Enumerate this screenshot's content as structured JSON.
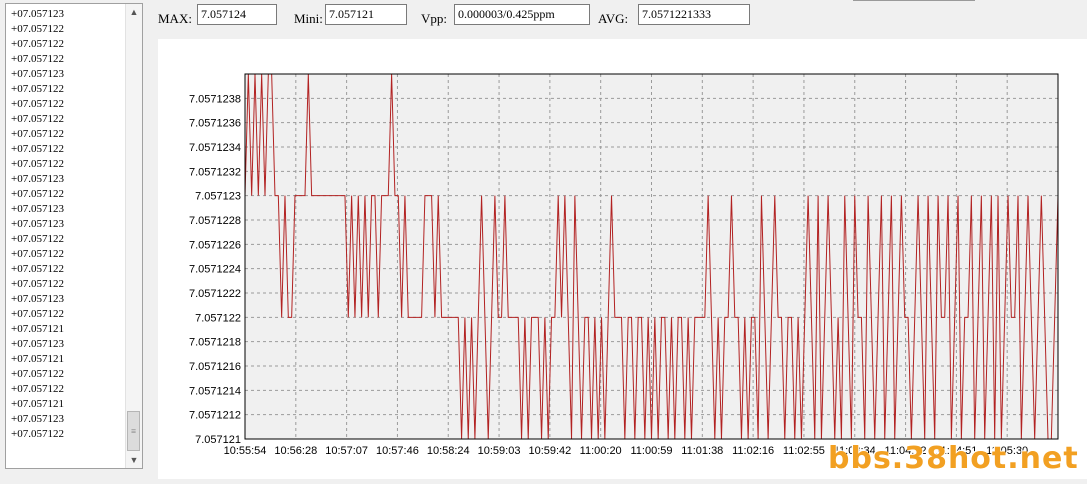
{
  "readings": [
    "+07.057123",
    "+07.057122",
    "+07.057122",
    "+07.057122",
    "+07.057123",
    "+07.057122",
    "+07.057122",
    "+07.057122",
    "+07.057122",
    "+07.057122",
    "+07.057122",
    "+07.057123",
    "+07.057122",
    "+07.057123",
    "+07.057123",
    "+07.057122",
    "+07.057122",
    "+07.057122",
    "+07.057122",
    "+07.057123",
    "+07.057122",
    "+07.057121",
    "+07.057123",
    "+07.057121",
    "+07.057122",
    "+07.057122",
    "+07.057121",
    "+07.057123",
    "+07.057122"
  ],
  "stats": {
    "max_label": "MAX:",
    "max_value": "7.057124",
    "mini_label": "Mini:",
    "mini_value": "7.057121",
    "vpp_label": "Vpp:",
    "vpp_value": "0.000003/0.425ppm",
    "avg_label": "AVG:",
    "avg_value": "7.0571221333"
  },
  "chart_data": {
    "type": "line",
    "title": "",
    "xlabel": "",
    "ylabel": "",
    "ylim": [
      7.057121,
      7.057124
    ],
    "y_ticks": [
      "7.057121",
      "7.0571212",
      "7.0571214",
      "7.0571216",
      "7.0571218",
      "7.057122",
      "7.0571222",
      "7.0571224",
      "7.0571226",
      "7.0571228",
      "7.057123",
      "7.0571232",
      "7.0571234",
      "7.0571236",
      "7.0571238"
    ],
    "x_ticks": [
      "10:55:54",
      "10:56:28",
      "10:57:07",
      "10:57:46",
      "10:58:24",
      "10:59:03",
      "10:59:42",
      "11:00:20",
      "11:00:59",
      "11:01:38",
      "11:02:16",
      "11:02:55",
      "11:03:34",
      "11:04:12",
      "11:04:51",
      "11:05:30"
    ],
    "grid": true,
    "line_color": "#b22222",
    "series": [
      {
        "values": [
          7.057123,
          7.057124,
          7.057123,
          7.057124,
          7.057123,
          7.057124,
          7.057123,
          7.057124,
          7.057124,
          7.057123,
          7.057123,
          7.057122,
          7.057123,
          7.057122,
          7.057122,
          7.057123,
          7.057123,
          7.057123,
          7.057123,
          7.057124,
          7.057123,
          7.057123,
          7.057123,
          7.057123,
          7.057123,
          7.057123,
          7.057123,
          7.057123,
          7.057123,
          7.057123,
          7.057123,
          7.057122,
          7.057123,
          7.057122,
          7.057123,
          7.057122,
          7.057123,
          7.057122,
          7.057123,
          7.057123,
          7.057122,
          7.057123,
          7.057123,
          7.057123,
          7.057124,
          7.057123,
          7.057123,
          7.057122,
          7.057123,
          7.057122,
          7.057122,
          7.057122,
          7.057122,
          7.057122,
          7.057123,
          7.057123,
          7.057123,
          7.057122,
          7.057123,
          7.057122,
          7.057122,
          7.057122,
          7.057122,
          7.057122,
          7.057122,
          7.057121,
          7.057122,
          7.057121,
          7.057122,
          7.057121,
          7.057122,
          7.057123,
          7.057122,
          7.057121,
          7.057122,
          7.057123,
          7.057122,
          7.057122,
          7.057123,
          7.057122,
          7.057122,
          7.057122,
          7.057122,
          7.057121,
          7.057122,
          7.057121,
          7.057122,
          7.057122,
          7.057122,
          7.057121,
          7.057122,
          7.057121,
          7.057122,
          7.057122,
          7.057123,
          7.057122,
          7.057123,
          7.057122,
          7.057121,
          7.057123,
          7.057122,
          7.057121,
          7.057122,
          7.057122,
          7.057121,
          7.057122,
          7.057121,
          7.057122,
          7.057121,
          7.057122,
          7.057123,
          7.057122,
          7.057122,
          7.057122,
          7.057121,
          7.057122,
          7.057122,
          7.057121,
          7.057122,
          7.057122,
          7.057121,
          7.057122,
          7.057121,
          7.057122,
          7.057121,
          7.057122,
          7.057122,
          7.057121,
          7.057122,
          7.057121,
          7.057122,
          7.057122,
          7.057121,
          7.057122,
          7.057121,
          7.057122,
          7.057122,
          7.057122,
          7.057122,
          7.057123,
          7.057122,
          7.057121,
          7.057122,
          7.057121,
          7.057122,
          7.057122,
          7.057123,
          7.057122,
          7.057122,
          7.057121,
          7.057122,
          7.057121,
          7.057122,
          7.057122,
          7.057121,
          7.057123,
          7.057122,
          7.057121,
          7.057122,
          7.057123,
          7.057122,
          7.057122,
          7.057121,
          7.057122,
          7.057122,
          7.057121,
          7.057122,
          7.057121,
          7.057122,
          7.057123,
          7.057122,
          7.057121,
          7.057123,
          7.057121,
          7.057122,
          7.057123,
          7.057122,
          7.057121,
          7.057122,
          7.057121,
          7.057123,
          7.057122,
          7.057121,
          7.057123,
          7.057122,
          7.057122,
          7.057121,
          7.057123,
          7.057122,
          7.057121,
          7.057122,
          7.057123,
          7.057121,
          7.057122,
          7.057123,
          7.057121,
          7.057122,
          7.057123,
          7.057122,
          7.057122,
          7.057121,
          7.057122,
          7.057123,
          7.057122,
          7.057121,
          7.057123,
          7.057122,
          7.057121,
          7.057123,
          7.057122,
          7.057122,
          7.057123,
          7.057121,
          7.057122,
          7.057123,
          7.057121,
          7.057122,
          7.057122,
          7.057123,
          7.057121,
          7.057122,
          7.057123,
          7.057121,
          7.057122,
          7.057123,
          7.057121,
          7.057123,
          7.057121,
          7.057122,
          7.057123,
          7.057122,
          7.057122,
          7.057123,
          7.057121,
          7.057122,
          7.057123,
          7.057122,
          7.057121,
          7.057122,
          7.057123,
          7.057122,
          7.057121,
          7.057121,
          7.057122,
          7.057123
        ]
      }
    ]
  },
  "watermark": "bbs.38hot.net"
}
